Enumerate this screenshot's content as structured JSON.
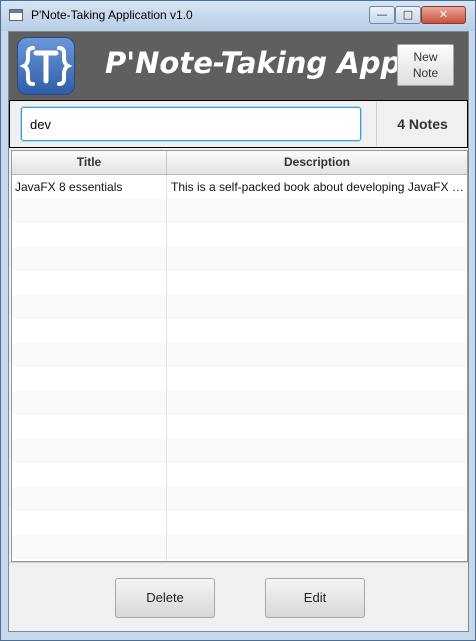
{
  "window": {
    "title": "P'Note-Taking Application v1.0",
    "app_icon": "window-icon",
    "controls": {
      "minimize": "minimize-icon",
      "maximize": "maximize-icon",
      "close": "close-icon"
    }
  },
  "header": {
    "logo_icon": "curly-brace-t-logo",
    "logo_color": "#3a6fbf",
    "title": "P'Note-Taking App",
    "new_note_line1": "New",
    "new_note_line2": "Note",
    "background": "#5f5f5f"
  },
  "search": {
    "value": "dev",
    "notes_count": "4 Notes",
    "accent": "#3aa0d6"
  },
  "table": {
    "columns": [
      "Title",
      "Description"
    ],
    "rows": [
      {
        "title": "JavaFX 8 essentials",
        "description": "This is a self-packed book about developing JavaFX o..."
      }
    ]
  },
  "footer": {
    "delete_label": "Delete",
    "edit_label": "Edit"
  }
}
